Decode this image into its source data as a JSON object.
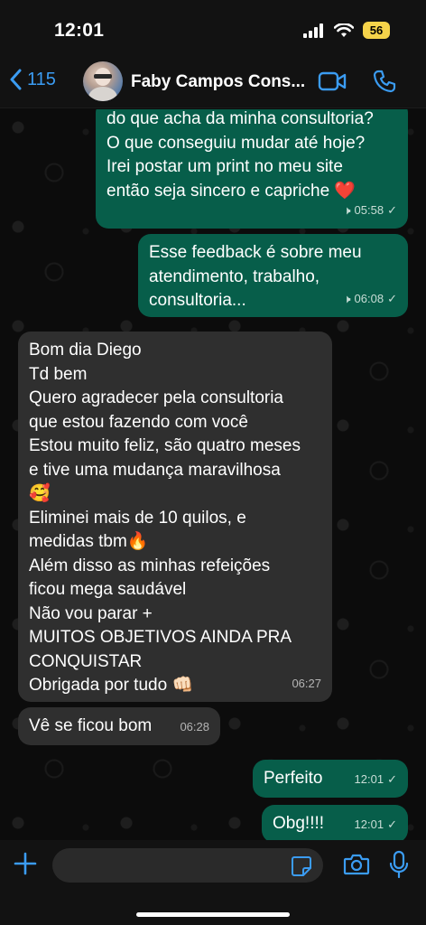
{
  "status": {
    "time": "12:01",
    "battery": "56"
  },
  "header": {
    "back_count": "115",
    "contact_name": "Faby Campos Cons..."
  },
  "messages": [
    {
      "text": "do que acha da minha consultoria?\nO que conseguiu mudar até hoje?\nIrei postar um print no meu site\nentão seja sincero e capriche ❤️",
      "time": "05:58"
    },
    {
      "text": "Esse feedback é sobre meu\natendimento, trabalho,\nconsultoria...",
      "time": "06:08"
    },
    {
      "text": "Bom dia Diego\nTd bem\nQuero agradecer pela consultoria\nque estou fazendo com você\nEstou muito feliz, são quatro meses\ne tive uma mudança maravilhosa\n🥰\nEliminei mais de 10 quilos, e\nmedidas tbm🔥\nAlém disso as minhas refeições\nficou mega saudável\nNão vou parar +\nMUITOS OBJETIVOS AINDA PRA\nCONQUISTAR\nObrigada por tudo 👊🏻",
      "time": "06:27"
    },
    {
      "text": "Vê se ficou bom",
      "time": "06:28"
    },
    {
      "text": "Perfeito",
      "time": "12:01"
    },
    {
      "text": "Obg!!!!",
      "time": "12:01"
    }
  ],
  "colors": {
    "accent": "#3b9cf2",
    "outgoing": "#075e4a",
    "incoming": "#2f2f2f"
  }
}
